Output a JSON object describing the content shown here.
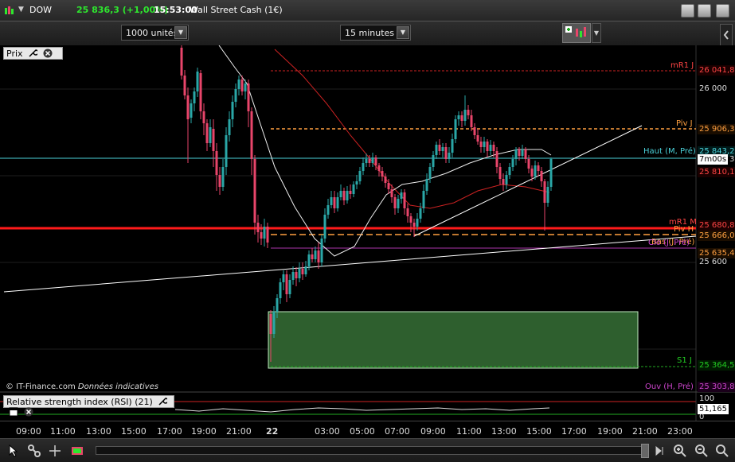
{
  "title_bar": {
    "symbol": "DOW",
    "price": "25 836,3 (+1,00%)",
    "time": "15:53:00",
    "instrument": "Wall Street Cash (1€)"
  },
  "toolbar": {
    "units_select": "1000 unités",
    "interval_select": "15 minutes"
  },
  "price_panel": {
    "title": "Prix",
    "footer_source": "© IT-Finance.com",
    "footer_note": "Données indicatives",
    "countdown": "7m00s",
    "countdown_suffix": "3",
    "axis_labels": [
      "26 000",
      "25 600"
    ],
    "price_tags": [
      {
        "text": "26 041,8",
        "color": "#ff4444"
      },
      {
        "text": "25 906,3",
        "color": "#ffa040"
      },
      {
        "text": "25 843,2",
        "color": "#4ad0d8"
      },
      {
        "text": "25 810,1",
        "color": "#ff4444"
      },
      {
        "text": "25 680,8",
        "color": "#ff4444"
      },
      {
        "text": "25 666,0",
        "color": "#ffa040"
      },
      {
        "text": "25 635,4",
        "color": "#ffa040"
      },
      {
        "text": "25 364,5",
        "color": "#22cc22"
      },
      {
        "text": "25 303,8",
        "color": "#cc44cc"
      }
    ],
    "line_labels": [
      {
        "text": "mR1 J",
        "color": "#ff4444"
      },
      {
        "text": "Piv J",
        "color": "#ffa040"
      },
      {
        "text": "Haut (M, Pré)",
        "color": "#4ad0d8"
      },
      {
        "text": "mR1 M",
        "color": "#ff4444"
      },
      {
        "text": "Piv H",
        "color": "#ffa040"
      },
      {
        "text": "Bas (J, Pré)",
        "color": "#ffa040"
      },
      {
        "text": "Clo (J, Pré)",
        "color": "#cc44cc"
      },
      {
        "text": "S1 J",
        "color": "#22cc22"
      },
      {
        "text": "Ouv (H, Pré)",
        "color": "#cc44cc"
      }
    ]
  },
  "rsi_panel": {
    "title": "Relative strength index (RSI) (21)",
    "axis_top": "100",
    "value": "51,165",
    "axis_bottom": "0"
  },
  "time_axis": [
    "09:00",
    "11:00",
    "13:00",
    "15:00",
    "17:00",
    "19:00",
    "21:00",
    "22",
    "03:00",
    "05:00",
    "07:00",
    "09:00",
    "11:00",
    "13:00",
    "15:00",
    "17:00",
    "19:00",
    "21:00",
    "23:00"
  ],
  "colors": {
    "up": "#2aa7a7",
    "down": "#e8456a",
    "support_line": "#ff1a1a",
    "pivot": "#ffa040",
    "green_zone": "#2e5f2e"
  },
  "icons": [
    "chart-logo-icon",
    "wrench-icon",
    "close-icon",
    "minimize-icon",
    "maximize-icon",
    "cursor-icon",
    "link-icon",
    "zoom-in-icon",
    "zoom-out-icon"
  ]
}
